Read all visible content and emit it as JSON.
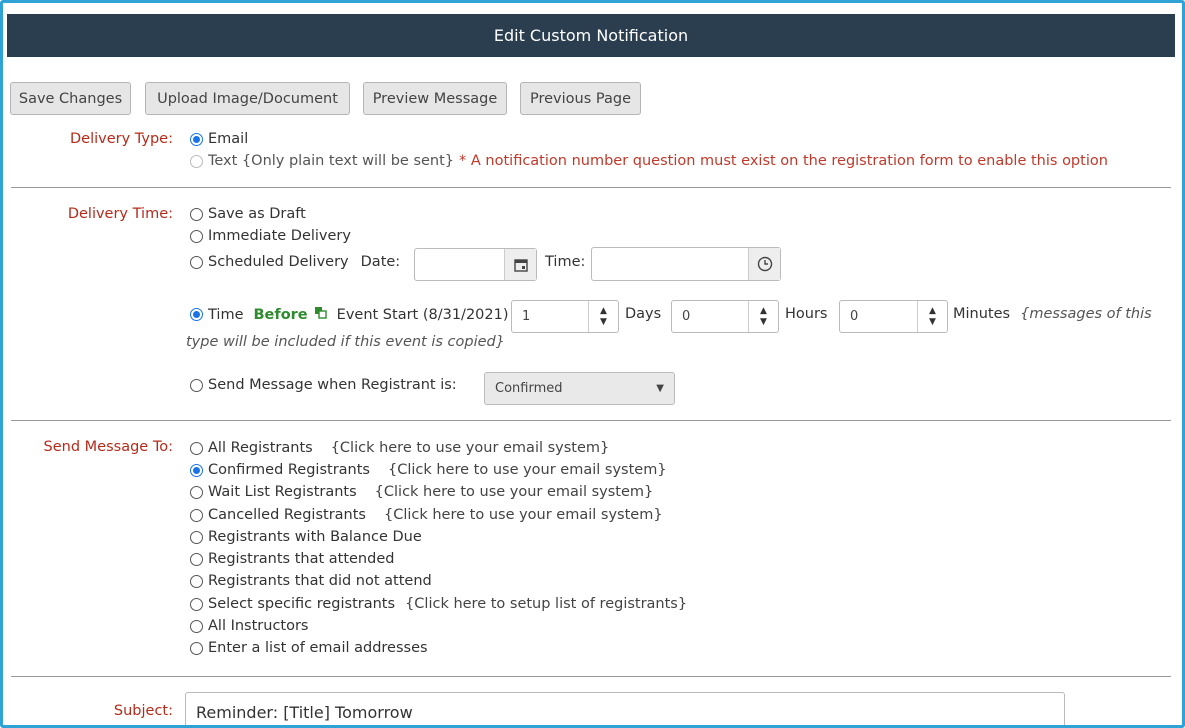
{
  "header": {
    "title": "Edit Custom Notification"
  },
  "toolbar": {
    "save_label": "Save Changes",
    "upload_label": "Upload Image/Document",
    "preview_label": "Preview Message",
    "previous_label": "Previous Page"
  },
  "delivery_type": {
    "label": "Delivery Type:",
    "email": "Email",
    "text": "Text {Only plain text will be sent}",
    "text_note": "* A notification number question must exist on the registration form to enable this option"
  },
  "delivery_time": {
    "label": "Delivery Time:",
    "draft": "Save as Draft",
    "immediate": "Immediate Delivery",
    "scheduled": "Scheduled Delivery",
    "date_label": "Date:",
    "time_label": "Time:",
    "time_option": "Time",
    "before": "Before",
    "event_start": "Event Start (8/31/2021)",
    "days_value": "1",
    "days_label": "Days",
    "hours_value": "0",
    "hours_label": "Hours",
    "minutes_value": "0",
    "minutes_label": "Minutes",
    "copy_note_1": "{messages of this",
    "copy_note_2": "type will be included if this event is copied}",
    "status_option": "Send Message when Registrant is:",
    "status_value": "Confirmed"
  },
  "send_to": {
    "label": "Send Message To:",
    "link_text": "{Click here to use your email system}",
    "setup_link": "{Click here to setup list of registrants}",
    "options": [
      "All Registrants",
      "Confirmed Registrants",
      "Wait List Registrants",
      "Cancelled Registrants",
      "Registrants with Balance Due",
      "Registrants that attended",
      "Registrants that did not attend",
      "Select specific registrants",
      "All Instructors",
      "Enter a list of email addresses"
    ]
  },
  "subject": {
    "label": "Subject:",
    "value": "Reminder: [Title] Tomorrow"
  }
}
